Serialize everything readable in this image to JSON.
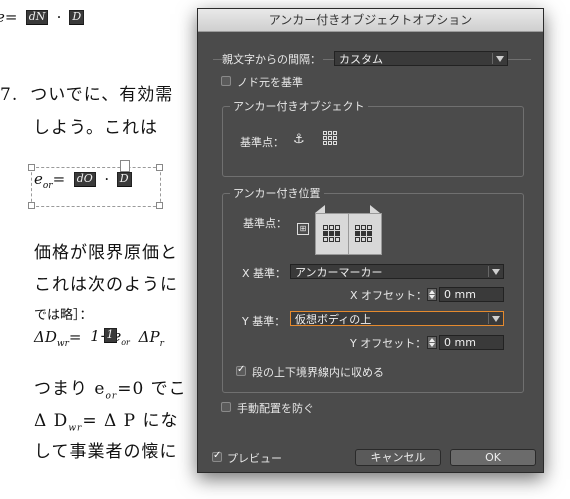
{
  "document": {
    "formula1": {
      "lhs": "e",
      "num1": "dN",
      "den1": "dD",
      "num2": "D",
      "den2": "N"
    },
    "line_7_number": "7.",
    "line_7_text": "ついでに、有効需",
    "line_8_text": "しよう。これは",
    "formula2": {
      "lhs": "e",
      "num1": "dO",
      "den1": "dD",
      "num2": "D",
      "den2": "O"
    },
    "para_line1": "価格が限界原価と",
    "para_line2": "これは次のように",
    "para_line3": "では略］：",
    "formula3": {
      "lhs": "ΔD",
      "eq": "=",
      "num": "1",
      "den": "1−e",
      "rhs": "ΔP"
    },
    "line_tsumari": "つまり e",
    "line_tsumari_rest": "=0 でこ",
    "line_delta": "Δ D",
    "line_delta_rest": "= Δ P  にな",
    "line_last": "して事業者の懐に"
  },
  "dialog": {
    "title": "アンカー付きオブジェクトオプション",
    "offset_label": "親文字からの間隔：",
    "offset_value": "カスタム",
    "root_label": "ノド元を基準",
    "group_anchored_object": "アンカー付きオブジェクト",
    "ref_point_label": "基準点：",
    "group_anchored_position": "アンカー付き位置",
    "ref_point_label2": "基準点：",
    "x_basis_label": "X 基準：",
    "x_basis_value": "アンカーマーカー",
    "x_offset_label": "X オフセット：",
    "x_offset_value": "0 mm",
    "y_basis_label": "Y 基準：",
    "y_basis_value": "仮想ボディの上",
    "y_offset_label": "Y オフセット：",
    "y_offset_value": "0 mm",
    "keep_within_label": "段の上下境界線内に収める",
    "prevent_manual_label": "手動配置を防ぐ",
    "preview_label": "プレビュー",
    "cancel_label": "キャンセル",
    "ok_label": "OK"
  }
}
